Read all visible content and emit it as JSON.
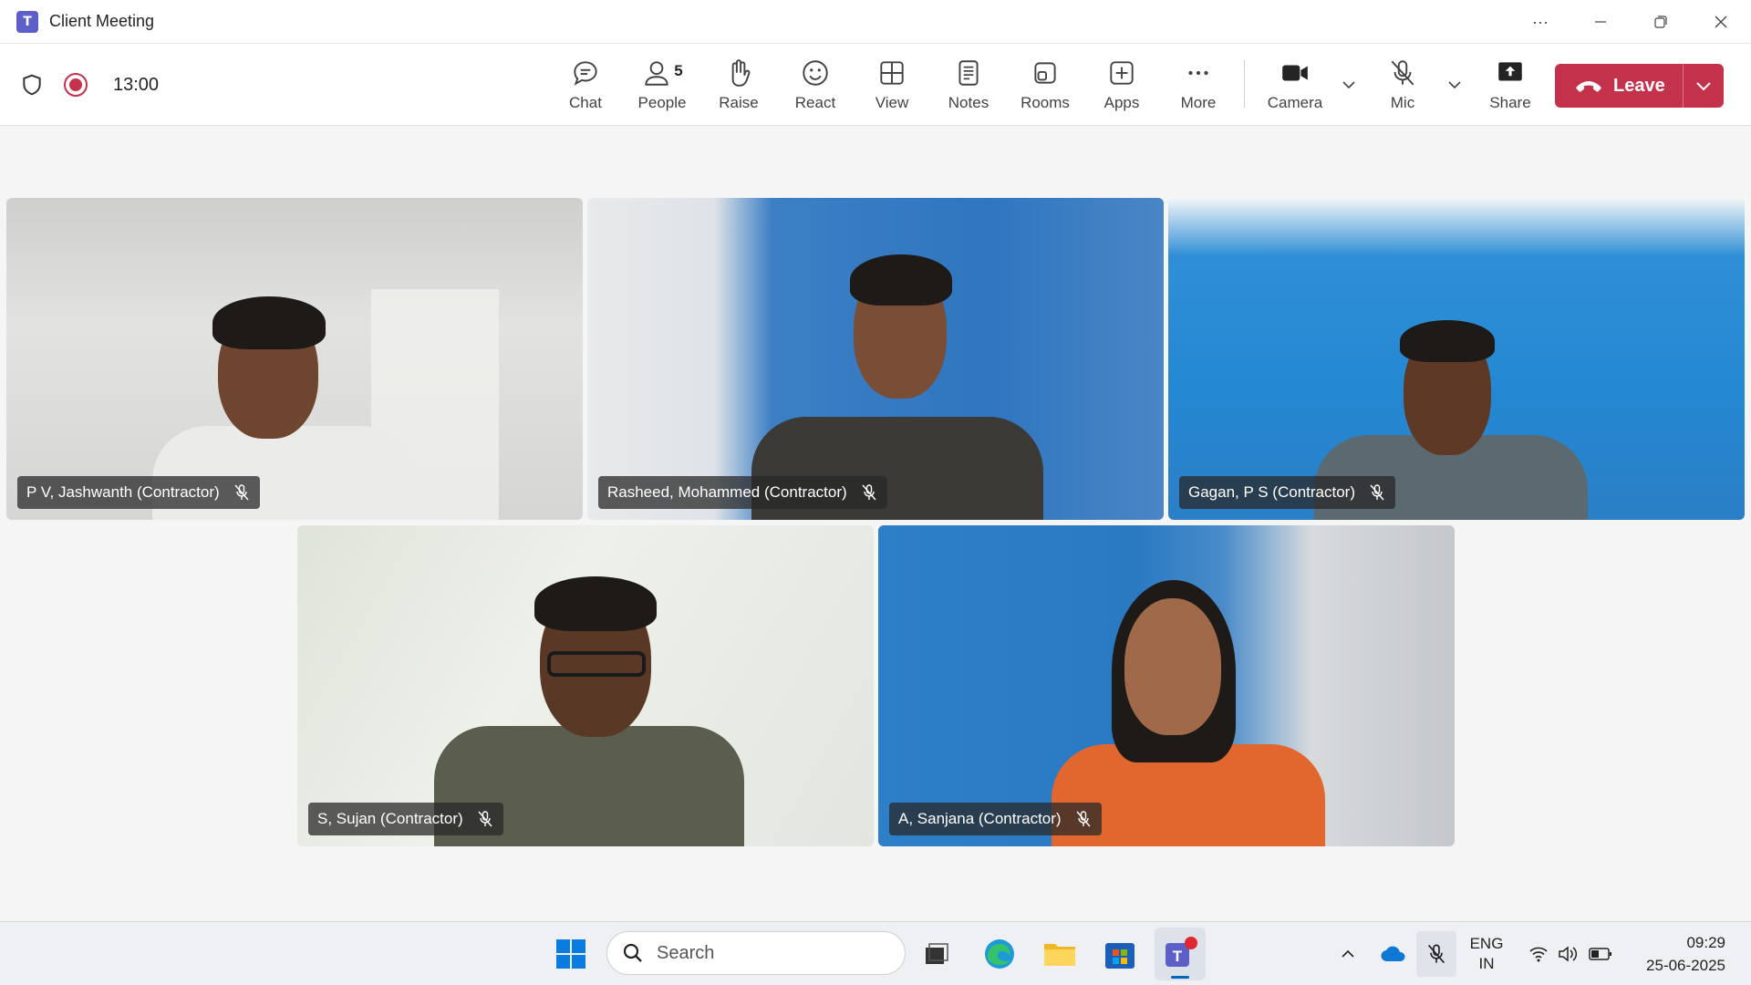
{
  "window": {
    "title": "Client Meeting",
    "controls": [
      "more-options",
      "minimize",
      "restore",
      "close"
    ]
  },
  "meeting": {
    "timer": "13:00",
    "recording": true,
    "people_count": "5",
    "toolbar": {
      "chat": "Chat",
      "people": "People",
      "raise": "Raise",
      "react": "React",
      "view": "View",
      "notes": "Notes",
      "rooms": "Rooms",
      "apps": "Apps",
      "more": "More",
      "camera": "Camera",
      "mic": "Mic",
      "share": "Share",
      "leave": "Leave"
    }
  },
  "participants": [
    {
      "name": "P V, Jashwanth (Contractor)",
      "muted": true
    },
    {
      "name": "Rasheed, Mohammed (Contractor)",
      "muted": true
    },
    {
      "name": "Gagan, P S (Contractor)",
      "muted": true
    },
    {
      "name": "S, Sujan (Contractor)",
      "muted": true
    },
    {
      "name": "A, Sanjana (Contractor)",
      "muted": true
    }
  ],
  "taskbar": {
    "search_placeholder": "Search",
    "language": "ENG",
    "region": "IN",
    "time": "09:29",
    "date": "25-06-2025"
  },
  "colors": {
    "leave_red": "#c4314b",
    "teams_purple": "#5b5fc7"
  }
}
